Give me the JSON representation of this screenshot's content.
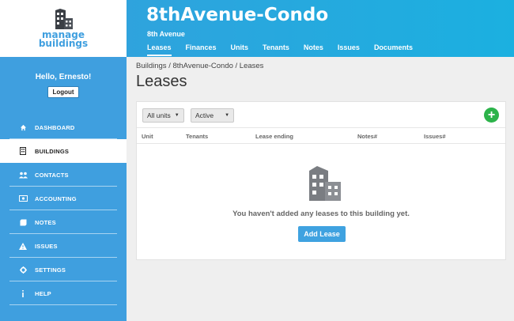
{
  "brand": {
    "line1": "manage",
    "line2": "buildings"
  },
  "user": {
    "greeting": "Hello, Ernesto!",
    "logout_label": "Logout"
  },
  "nav": [
    {
      "label": "DASHBOARD",
      "icon": "home-icon"
    },
    {
      "label": "BUILDINGS",
      "icon": "building-icon",
      "active": true
    },
    {
      "label": "CONTACTS",
      "icon": "people-icon"
    },
    {
      "label": "ACCOUNTING",
      "icon": "money-icon"
    },
    {
      "label": "NOTES",
      "icon": "note-icon"
    },
    {
      "label": "ISSUES",
      "icon": "warning-icon"
    },
    {
      "label": "SETTINGS",
      "icon": "gear-icon"
    },
    {
      "label": "HELP",
      "icon": "info-icon"
    }
  ],
  "header": {
    "title": "8thAvenue-Condo",
    "subtitle": "8th Avenue",
    "tabs": [
      "Leases",
      "Finances",
      "Units",
      "Tenants",
      "Notes",
      "Issues",
      "Documents"
    ],
    "active_tab": "Leases"
  },
  "breadcrumb": "Buildings / 8thAvenue-Condo / Leases",
  "page_title": "Leases",
  "filters": {
    "units": "All units",
    "status": "Active"
  },
  "table": {
    "columns": [
      "Unit",
      "Tenants",
      "Lease ending",
      "Notes#",
      "Issues#"
    ]
  },
  "empty_state": {
    "message": "You haven't added any leases to this building yet.",
    "button_label": "Add Lease"
  },
  "colors": {
    "primary": "#3f9fdf",
    "header": "#1bb0e0",
    "add": "#2cb34a"
  }
}
